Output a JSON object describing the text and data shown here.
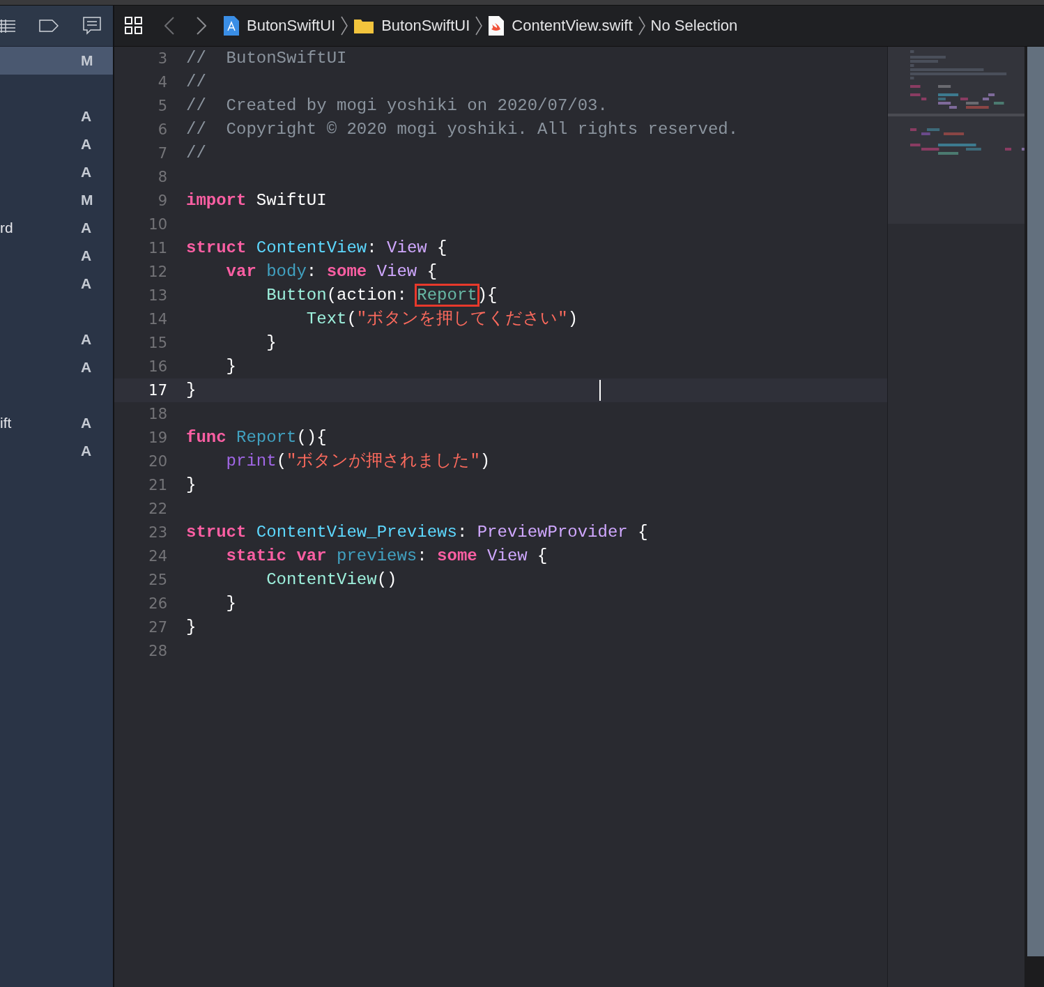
{
  "sidebar": {
    "rows": [
      {
        "selected": true,
        "status": "M"
      },
      {
        "selected": false
      },
      {
        "selected": false,
        "status": "A"
      },
      {
        "selected": false,
        "status": "A"
      },
      {
        "selected": false,
        "status": "A"
      },
      {
        "selected": false,
        "status": "M"
      },
      {
        "selected": false,
        "label": "rd",
        "status": "A"
      },
      {
        "selected": false,
        "status": "A"
      },
      {
        "selected": false,
        "status": "A"
      },
      {
        "selected": false
      },
      {
        "selected": false,
        "status": "A"
      },
      {
        "selected": false,
        "status": "A"
      },
      {
        "selected": false
      },
      {
        "selected": false,
        "label": "ift",
        "status": "A"
      },
      {
        "selected": false,
        "status": "A"
      }
    ]
  },
  "breadcrumbs": [
    {
      "kind": "project",
      "label": "ButonSwiftUI"
    },
    {
      "kind": "folder",
      "label": "ButonSwiftUI"
    },
    {
      "kind": "swift",
      "label": "ContentView.swift"
    },
    {
      "kind": "plain",
      "label": "No Selection"
    }
  ],
  "editor": {
    "lines": [
      {
        "number": "3",
        "current": false,
        "tokens": [
          {
            "kind": "comment",
            "text": "//  ButonSwiftUI"
          }
        ]
      },
      {
        "number": "4",
        "current": false,
        "tokens": [
          {
            "kind": "comment",
            "text": "//"
          }
        ]
      },
      {
        "number": "5",
        "current": false,
        "tokens": [
          {
            "kind": "comment",
            "text": "//  Created by mogi yoshiki on 2020/07/03."
          }
        ]
      },
      {
        "number": "6",
        "current": false,
        "tokens": [
          {
            "kind": "comment",
            "text": "//  Copyright © 2020 mogi yoshiki. All rights reserved."
          }
        ]
      },
      {
        "number": "7",
        "current": false,
        "tokens": [
          {
            "kind": "comment",
            "text": "//"
          }
        ]
      },
      {
        "number": "8",
        "current": false
      },
      {
        "number": "9",
        "current": false,
        "tokens": [
          {
            "kind": "keyword",
            "text": "import"
          },
          {
            "kind": "plain",
            "text": " SwiftUI"
          }
        ]
      },
      {
        "number": "10",
        "current": false
      },
      {
        "number": "11",
        "current": false,
        "tokens": [
          {
            "kind": "keyword",
            "text": "struct "
          },
          {
            "kind": "decl-type",
            "text": "ContentView"
          },
          {
            "kind": "plain",
            "text": ": "
          },
          {
            "kind": "type",
            "text": "View"
          },
          {
            "kind": "plain",
            "text": " {"
          }
        ]
      },
      {
        "number": "12",
        "current": false,
        "tokens": [
          {
            "kind": "keyword",
            "text": "    var "
          },
          {
            "kind": "decl",
            "text": "body"
          },
          {
            "kind": "plain",
            "text": ": "
          },
          {
            "kind": "keyword",
            "text": "some "
          },
          {
            "kind": "type",
            "text": "View"
          },
          {
            "kind": "plain",
            "text": " {"
          }
        ]
      },
      {
        "number": "13",
        "current": false,
        "tokens": [
          {
            "kind": "call",
            "text": "        Button"
          },
          {
            "kind": "plain",
            "text": "(action: "
          },
          {
            "kind": "project",
            "text": "Report",
            "boxed": true
          },
          {
            "kind": "plain",
            "text": "){"
          }
        ]
      },
      {
        "number": "14",
        "current": false,
        "tokens": [
          {
            "kind": "call",
            "text": "            Text"
          },
          {
            "kind": "plain",
            "text": "("
          },
          {
            "kind": "string",
            "text": "\"ボタンを押してください\""
          },
          {
            "kind": "plain",
            "text": ")"
          }
        ]
      },
      {
        "number": "15",
        "current": false,
        "tokens": [
          {
            "kind": "plain",
            "text": "        }"
          }
        ]
      },
      {
        "number": "16",
        "current": false,
        "tokens": [
          {
            "kind": "plain",
            "text": "    }"
          }
        ]
      },
      {
        "number": "17",
        "current": true,
        "tokens": [
          {
            "kind": "plain",
            "text": "}"
          }
        ]
      },
      {
        "number": "18",
        "current": false
      },
      {
        "number": "19",
        "current": false,
        "tokens": [
          {
            "kind": "keyword",
            "text": "func "
          },
          {
            "kind": "decl",
            "text": "Report"
          },
          {
            "kind": "plain",
            "text": "(){"
          }
        ]
      },
      {
        "number": "20",
        "current": false,
        "tokens": [
          {
            "kind": "builtin",
            "text": "    print"
          },
          {
            "kind": "plain",
            "text": "("
          },
          {
            "kind": "string",
            "text": "\"ボタンが押されました\""
          },
          {
            "kind": "plain",
            "text": ")"
          }
        ]
      },
      {
        "number": "21",
        "current": false,
        "tokens": [
          {
            "kind": "plain",
            "text": "}"
          }
        ]
      },
      {
        "number": "22",
        "current": false
      },
      {
        "number": "23",
        "current": false,
        "tokens": [
          {
            "kind": "keyword",
            "text": "struct "
          },
          {
            "kind": "decl-type",
            "text": "ContentView_Previews"
          },
          {
            "kind": "plain",
            "text": ": "
          },
          {
            "kind": "type",
            "text": "PreviewProvider"
          },
          {
            "kind": "plain",
            "text": " {"
          }
        ]
      },
      {
        "number": "24",
        "current": false,
        "tokens": [
          {
            "kind": "keyword",
            "text": "    static var "
          },
          {
            "kind": "decl",
            "text": "previews"
          },
          {
            "kind": "plain",
            "text": ": "
          },
          {
            "kind": "keyword",
            "text": "some "
          },
          {
            "kind": "type",
            "text": "View"
          },
          {
            "kind": "plain",
            "text": " {"
          }
        ]
      },
      {
        "number": "25",
        "current": false,
        "tokens": [
          {
            "kind": "call",
            "text": "        ContentView"
          },
          {
            "kind": "plain",
            "text": "()"
          }
        ]
      },
      {
        "number": "26",
        "current": false,
        "tokens": [
          {
            "kind": "plain",
            "text": "    }"
          }
        ]
      },
      {
        "number": "27",
        "current": false,
        "tokens": [
          {
            "kind": "plain",
            "text": "}"
          }
        ]
      },
      {
        "number": "28",
        "current": false
      }
    ]
  }
}
